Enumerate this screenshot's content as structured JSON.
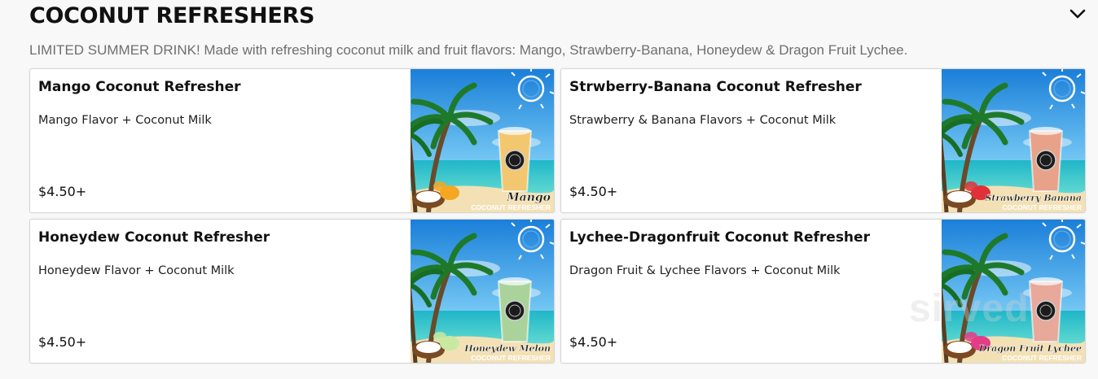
{
  "section": {
    "title": "COCONUT REFRESHERS",
    "description": "LIMITED SUMMER DRINK! Made with refreshing coconut milk and fruit flavors: Mango, Strawberry-Banana, Honeydew & Dragon Fruit Lychee.",
    "collapse_icon": "chevron-down-icon"
  },
  "items": [
    {
      "name": "Mango Coconut Refresher",
      "description": "Mango Flavor + Coconut Milk",
      "price": "$4.50+",
      "image_label": "Mango",
      "image_sublabel": "COCONUT REFRESHER",
      "drink_color": "#f2c770",
      "fruit_color": "#f5a623"
    },
    {
      "name": "Strwberry-Banana Coconut Refresher",
      "description": "Strawberry & Banana Flavors + Coconut Milk",
      "price": "$4.50+",
      "image_label": "Strawberry Banana",
      "image_sublabel": "COCONUT REFRESHER",
      "drink_color": "#e8a289",
      "fruit_color": "#e0313a"
    },
    {
      "name": "Honeydew Coconut Refresher",
      "description": "Honeydew Flavor + Coconut Milk",
      "price": "$4.50+",
      "image_label": "Honeydew Melon",
      "image_sublabel": "COCONUT REFRESHER",
      "drink_color": "#a9d39a",
      "fruit_color": "#c9e8a0"
    },
    {
      "name": "Lychee-Dragonfruit Coconut Refresher",
      "description": "Dragon Fruit & Lychee Flavors + Coconut Milk",
      "price": "$4.50+",
      "image_label": "Dragon Fruit Lychee",
      "image_sublabel": "COCONUT REFRESHER",
      "drink_color": "#e8a89a",
      "fruit_color": "#e43c86"
    }
  ],
  "watermark": "sirved"
}
